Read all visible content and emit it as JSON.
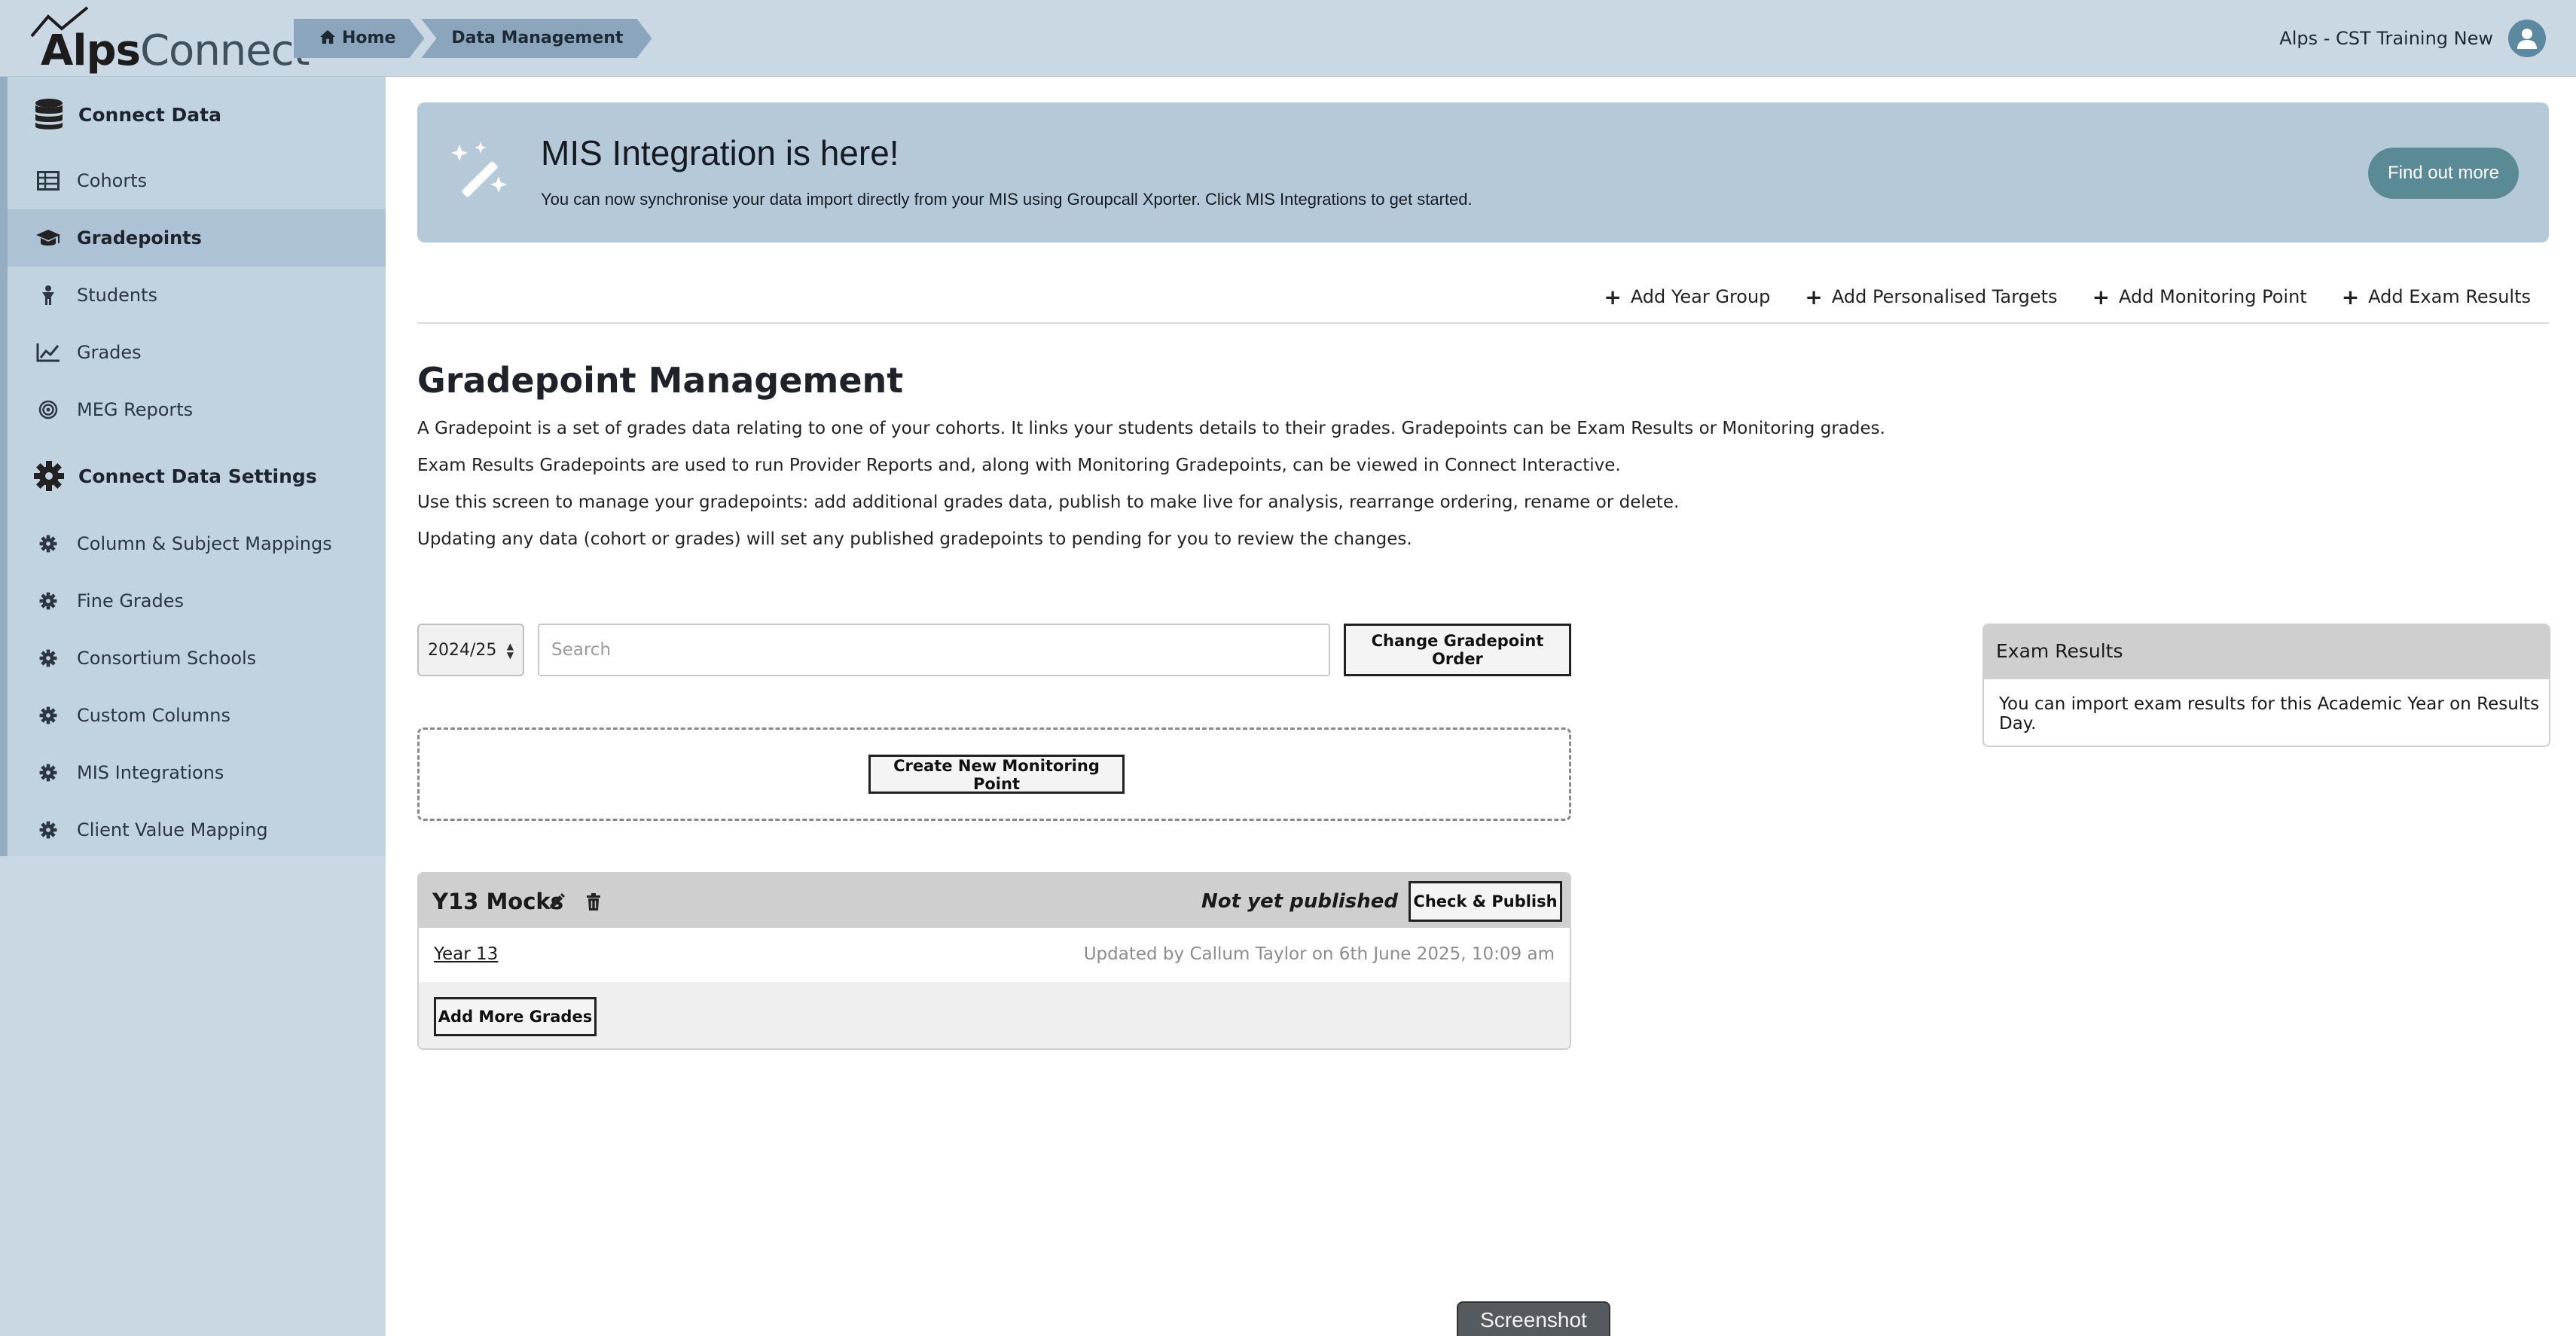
{
  "app": {
    "logo_alps": "Alps",
    "logo_connect": "Connect"
  },
  "breadcrumb": [
    "Home",
    "Data Management"
  ],
  "user": {
    "name": "Alps - CST Training New"
  },
  "sidebar": {
    "items": [
      {
        "label": "Connect Data",
        "icon": "database-icon",
        "kind": "heading"
      },
      {
        "label": "Cohorts",
        "icon": "table-icon"
      },
      {
        "label": "Gradepoints",
        "icon": "graduation-cap-icon",
        "active": true
      },
      {
        "label": "Students",
        "icon": "student-icon"
      },
      {
        "label": "Grades",
        "icon": "line-chart-icon"
      },
      {
        "label": "MEG Reports",
        "icon": "target-icon"
      },
      {
        "label": "Connect Data Settings",
        "icon": "gear-icon",
        "kind": "heading"
      },
      {
        "label": "Column & Subject Mappings",
        "icon": "gear-icon"
      },
      {
        "label": "Fine Grades",
        "icon": "gear-icon"
      },
      {
        "label": "Consortium Schools",
        "icon": "gear-icon"
      },
      {
        "label": "Custom Columns",
        "icon": "gear-icon"
      },
      {
        "label": "MIS Integrations",
        "icon": "gear-icon"
      },
      {
        "label": "Client Value Mapping",
        "icon": "gear-icon"
      }
    ]
  },
  "banner": {
    "title": "MIS Integration is here!",
    "text": "You can now synchronise your data import directly from your MIS using Groupcall Xporter. Click MIS Integrations to get started.",
    "button": "Find out more",
    "icon": "magic-wand-icon"
  },
  "actions": [
    "Add Year Group",
    "Add Personalised Targets",
    "Add Monitoring Point",
    "Add Exam Results"
  ],
  "page": {
    "title": "Gradepoint Management",
    "description": [
      "A Gradepoint is a set of grades data relating to one of your cohorts. It links your students details to their grades. Gradepoints can be Exam Results or Monitoring grades.",
      "Exam Results Gradepoints are used to run Provider Reports and, along with Monitoring Gradepoints, can be viewed in Connect Interactive.",
      "Use this screen to manage your gradepoints: add additional grades data, publish to make live for analysis, rearrange ordering, rename or delete.",
      "Updating any data (cohort or grades) will set any published gradepoints to pending for you to review the changes."
    ]
  },
  "filters": {
    "year": "2024/25",
    "search_placeholder": "Search",
    "change_order": "Change Gradepoint Order"
  },
  "create_button": "Create New Monitoring Point",
  "gradepoint": {
    "title": "Y13 Mocks",
    "status": "Not yet published",
    "publish_button": "Check & Publish",
    "year_link": "Year 13",
    "updated": "Updated by Callum Taylor on 6th June 2025, 10:09 am",
    "add_more": "Add More Grades"
  },
  "exam_results": {
    "title": "Exam Results",
    "text": "You can import exam results for this Academic Year on Results Day."
  },
  "screenshot_tab": "Screenshot",
  "colors": {
    "topbar": "#c9d8e3",
    "sidebar": "#c2d3e0",
    "active_item": "#adc3d5",
    "banner": "#b6c9d8",
    "primary_button": "#5b8a97",
    "breadcrumb": "#8ba6bc"
  }
}
